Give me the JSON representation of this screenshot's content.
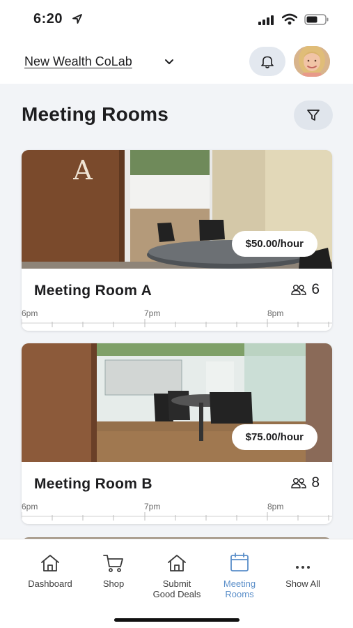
{
  "status_bar": {
    "time": "6:20"
  },
  "header": {
    "org_name": "New Wealth CoLab"
  },
  "page": {
    "title": "Meeting Rooms"
  },
  "rooms": [
    {
      "name": "Meeting Room A",
      "price": "$50.00/hour",
      "capacity": "6",
      "timeline": [
        "6pm",
        "7pm",
        "8pm"
      ]
    },
    {
      "name": "Meeting Room B",
      "price": "$75.00/hour",
      "capacity": "8",
      "timeline": [
        "6pm",
        "7pm",
        "8pm"
      ]
    }
  ],
  "bottom_nav": {
    "items": [
      {
        "label": "Dashboard",
        "icon": "home-icon"
      },
      {
        "label": "Shop",
        "icon": "cart-icon"
      },
      {
        "label": "Submit\nGood  Deals",
        "icon": "home-icon"
      },
      {
        "label": "Meeting\nRooms",
        "icon": "calendar-icon",
        "active": true
      },
      {
        "label": "Show All",
        "icon": "more-icon"
      }
    ],
    "active_color": "#5a8ec9"
  }
}
